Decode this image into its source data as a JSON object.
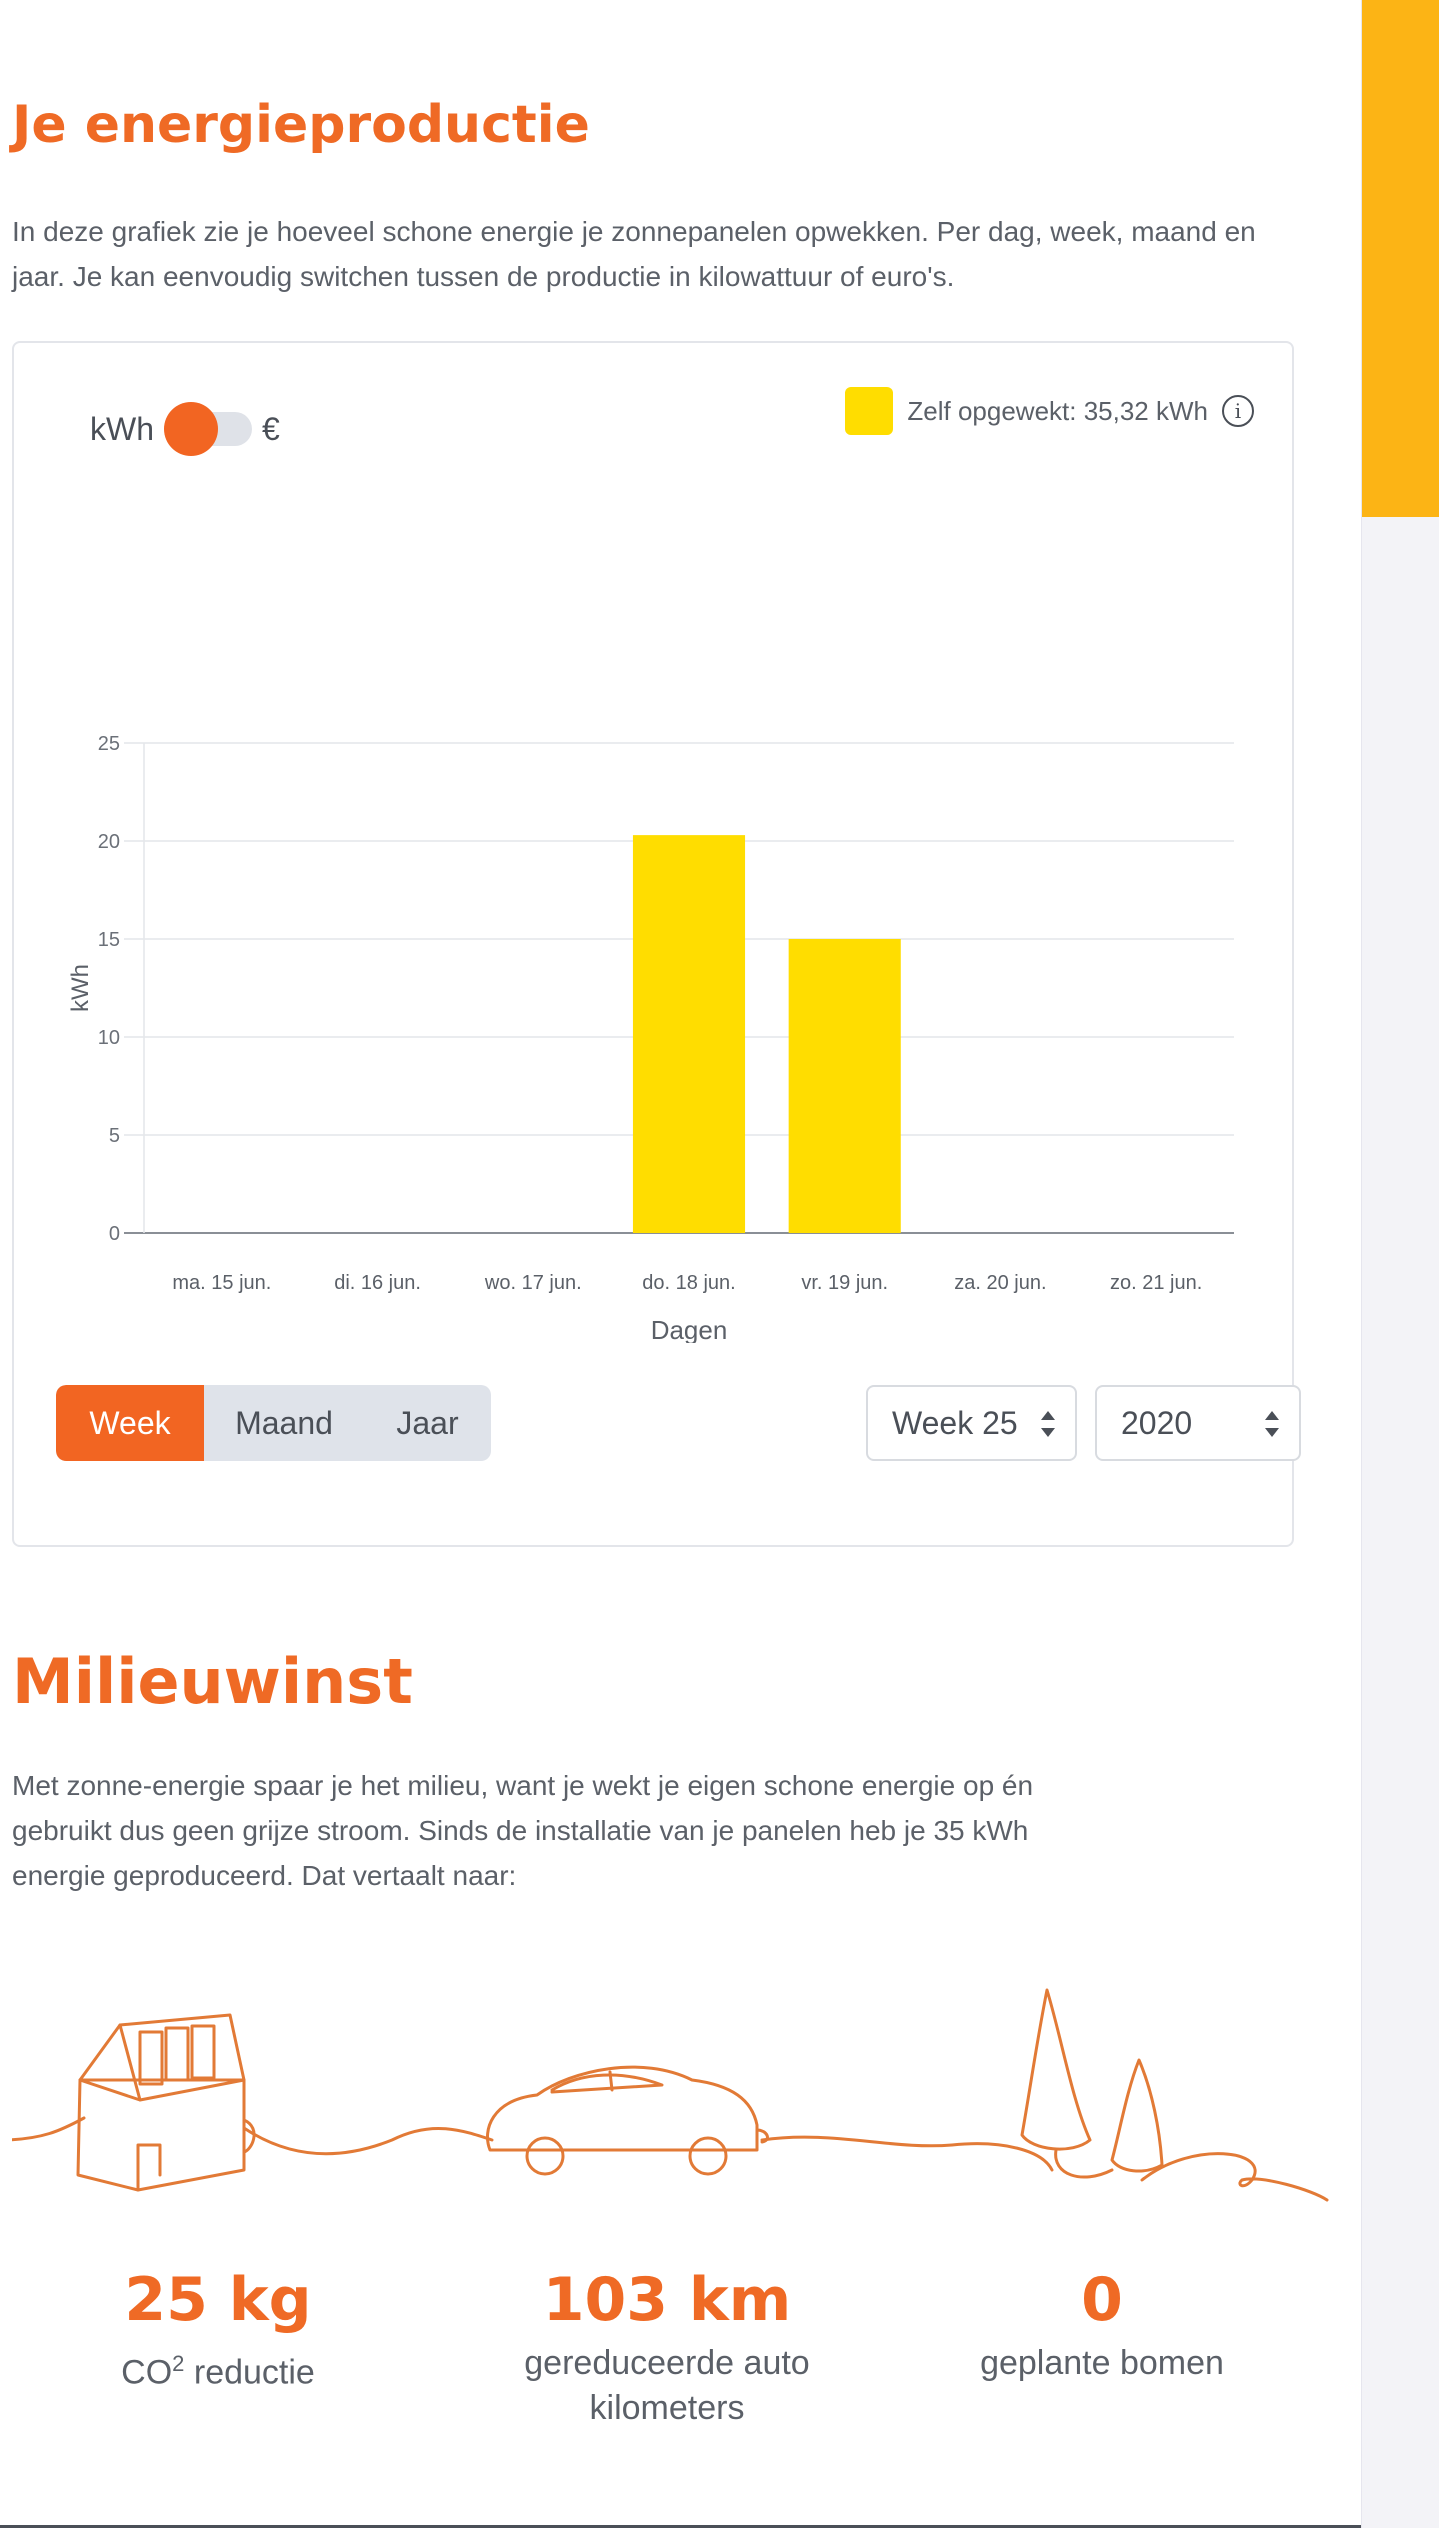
{
  "production": {
    "title": "Je energieproductie",
    "description": "In deze grafiek zie je hoeveel schone energie je zonnepanelen opwekken. Per dag, week, maand en jaar. Je kan eenvoudig switchen tussen de productie in kilowattuur of euro's.",
    "toggle": {
      "left_label": "kWh",
      "right_label": "€"
    },
    "legend": {
      "label": "Zelf opgewekt: 35,32 kWh",
      "color": "#ffdd00"
    },
    "period_tabs": [
      "Week",
      "Maand",
      "Jaar"
    ],
    "active_tab": "Week",
    "week_select": "Week 25",
    "year_select": "2020"
  },
  "chart_data": {
    "type": "bar",
    "categories": [
      "ma. 15 jun.",
      "di. 16 jun.",
      "wo. 17 jun.",
      "do. 18 jun.",
      "vr. 19 jun.",
      "za. 20 jun.",
      "zo. 21 jun."
    ],
    "series": [
      {
        "values": [
          0,
          0,
          0,
          20.3,
          15.0,
          0,
          0
        ],
        "color": "#ffdd00"
      }
    ],
    "xlabel": "Dagen",
    "ylabel": "kWh",
    "ylim": [
      0,
      25
    ],
    "yticks": [
      0,
      5,
      10,
      15,
      20,
      25
    ],
    "grid": true
  },
  "milieuwinst": {
    "title": "Milieuwinst",
    "description": "Met zonne-energie spaar je het milieu, want je wekt je eigen schone energie op én gebruikt dus geen grijze stroom. Sinds de installatie van je panelen heb je 35 kWh energie geproduceerd. Dat vertaalt naar:",
    "stats": [
      {
        "value": "25 kg",
        "label_main": "CO",
        "label_sup": "2",
        "label_rest": " reductie"
      },
      {
        "value": "103 km",
        "label": "gereduceerde auto kilometers"
      },
      {
        "value": "0",
        "label": "geplante bomen"
      }
    ]
  },
  "colors": {
    "accent": "#ef6a25",
    "sidebar_accent": "#fcb415",
    "bar": "#ffdd00"
  }
}
